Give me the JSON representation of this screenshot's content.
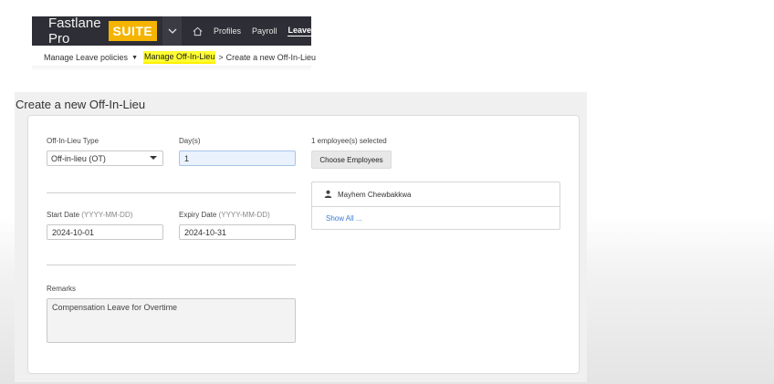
{
  "nav": {
    "brand": "Fastlane Pro",
    "suite": "SUITE",
    "items": [
      "Profiles",
      "Payroll",
      "Leave"
    ],
    "active": "Leave"
  },
  "breadcrumb": {
    "root": "Manage Leave policies",
    "link": "Manage Off-In-Lieu",
    "separator": ">",
    "current": "Create a new Off-In-Lieu"
  },
  "page": {
    "title": "Create a new Off-In-Lieu"
  },
  "form": {
    "type_label": "Off-In-Lieu Type",
    "type_value": "Off-in-lieu (OT)",
    "days_label": "Day(s)",
    "days_value": "1",
    "start_label": "Start Date",
    "start_hint": "(YYYY-MM-DD)",
    "start_value": "2024-10-01",
    "expiry_label": "Expiry Date",
    "expiry_hint": "(YYYY-MM-DD)",
    "expiry_value": "2024-10-31",
    "remarks_label": "Remarks",
    "remarks_value": "Compensation Leave for Overtime"
  },
  "employees": {
    "selected_text": "1 employee(s) selected",
    "choose_label": "Choose Employees",
    "list": [
      "Mayhem Chewbakkwa"
    ],
    "show_all": "Show All ..."
  },
  "colors": {
    "nav_bg": "#2e2e36",
    "suite_accent": "#f5b400",
    "highlight": "#ffff33",
    "link": "#3a7bd5"
  }
}
